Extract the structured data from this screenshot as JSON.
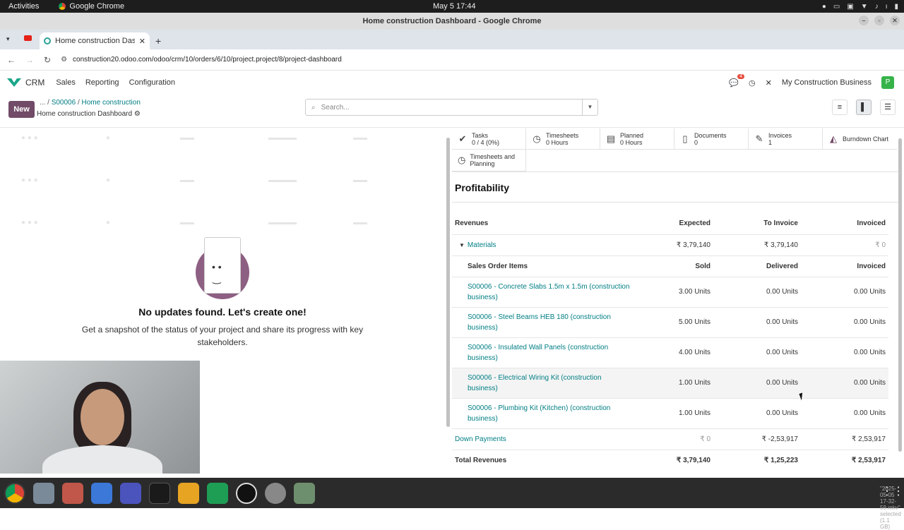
{
  "os": {
    "activities": "Activities",
    "app_name": "Google Chrome",
    "clock": "May 5  17:44"
  },
  "window": {
    "title": "Home construction Dashboard - Google Chrome"
  },
  "browser": {
    "tab_title": "Home construction Dash",
    "url": "construction20.odoo.com/odoo/crm/10/orders/6/10/project.project/8/project-dashboard",
    "profile_initial": "P"
  },
  "odoo_nav": {
    "app": "CRM",
    "menu": [
      "Sales",
      "Reporting",
      "Configuration"
    ],
    "chat_badge": "4",
    "company": "My Construction Business",
    "user_initial": "P"
  },
  "control_panel": {
    "new_label": "New",
    "breadcrumb_ellipsis": "...",
    "breadcrumb": [
      "S00006",
      "Home construction"
    ],
    "subtitle": "Home construction Dashboard",
    "search_placeholder": "Search..."
  },
  "left_panel": {
    "empty_title": "No updates found. Let's create one!",
    "empty_text": "Get a snapshot of the status of your project and share its progress with key stakeholders."
  },
  "stat_buttons": [
    {
      "icon": "check-icon",
      "label": "Tasks",
      "value": "0 / 4 (0%)"
    },
    {
      "icon": "clock-icon",
      "label": "Timesheets",
      "value": "0 Hours"
    },
    {
      "icon": "planning-icon",
      "label": "Planned",
      "value": "0 Hours"
    },
    {
      "icon": "document-icon",
      "label": "Documents",
      "value": "0"
    },
    {
      "icon": "invoice-icon",
      "label": "Invoices",
      "value": "1"
    },
    {
      "icon": "chart-area-icon",
      "label": "Burndown Chart",
      "value": ""
    },
    {
      "icon": "clock-icon",
      "label": "Timesheets and Planning",
      "value": ""
    }
  ],
  "profitability": {
    "title": "Profitability",
    "header": {
      "label": "Revenues",
      "expected": "Expected",
      "to_invoice": "To Invoice",
      "invoiced": "Invoiced"
    },
    "materials": {
      "label": "Materials",
      "expected": "₹ 3,79,140",
      "to_invoice": "₹ 3,79,140",
      "invoiced": "₹ 0"
    },
    "sub_header": {
      "label": "Sales Order Items",
      "sold": "Sold",
      "delivered": "Delivered",
      "invoiced": "Invoiced"
    },
    "items": [
      {
        "name": "S00006 - Concrete Slabs 1.5m x 1.5m (construction business)",
        "sold": "3.00 Units",
        "delivered": "0.00 Units",
        "invoiced": "0.00 Units"
      },
      {
        "name": "S00006 - Steel Beams HEB 180 (construction business)",
        "sold": "5.00 Units",
        "delivered": "0.00 Units",
        "invoiced": "0.00 Units"
      },
      {
        "name": "S00006 - Insulated Wall Panels (construction business)",
        "sold": "4.00 Units",
        "delivered": "0.00 Units",
        "invoiced": "0.00 Units"
      },
      {
        "name": "S00006 - Electrical Wiring Kit (construction business)",
        "sold": "1.00 Units",
        "delivered": "0.00 Units",
        "invoiced": "0.00 Units"
      },
      {
        "name": "S00006 - Plumbing Kit (Kitchen) (construction business)",
        "sold": "1.00 Units",
        "delivered": "0.00 Units",
        "invoiced": "0.00 Units"
      }
    ],
    "down_payments": {
      "label": "Down Payments",
      "expected": "₹ 0",
      "to_invoice": "₹ -2,53,917",
      "invoiced": "₹ 2,53,917"
    },
    "total": {
      "label": "Total Revenues",
      "expected": "₹ 3,79,140",
      "to_invoice": "₹ 1,25,223",
      "invoiced": "₹ 2,53,917"
    }
  },
  "taskbar": {
    "status": "\"2025-05-05 17-32-59.mkv\" selected  (1.1 GB)"
  }
}
